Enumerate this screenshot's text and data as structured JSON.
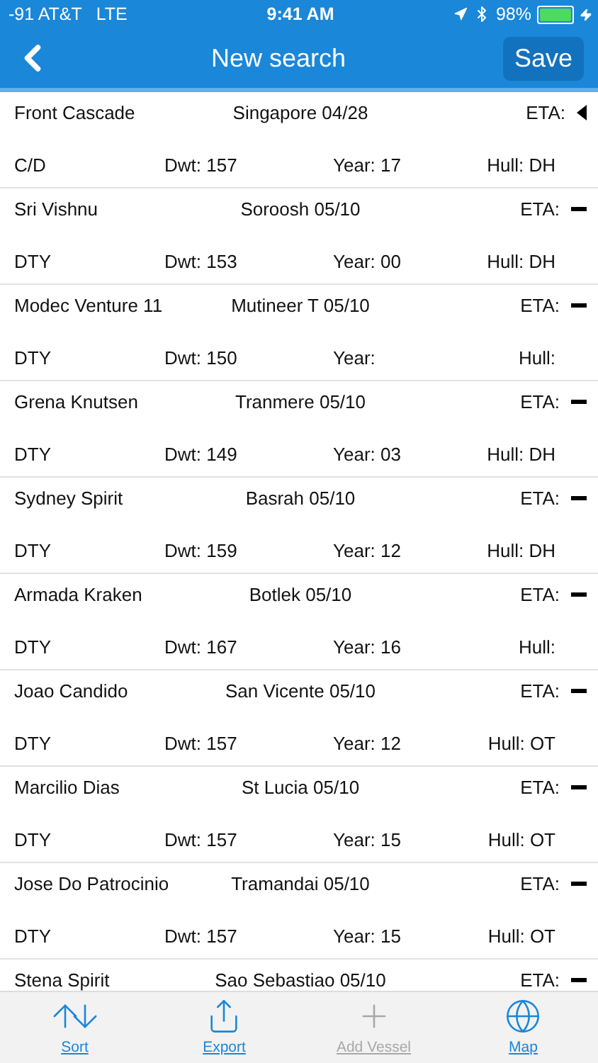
{
  "status_bar": {
    "carrier": "-91 AT&T",
    "network": "LTE",
    "time": "9:41 AM",
    "battery": "98%"
  },
  "nav": {
    "title": "New search",
    "action": "Save"
  },
  "vessels": [
    {
      "name": "Front Cascade",
      "port": "Singapore 04/28",
      "eta": "ETA:",
      "kind": "triangle",
      "type": "C/D",
      "dwt": "Dwt: 157",
      "year": "Year: 17",
      "hull": "Hull: DH"
    },
    {
      "name": "Sri Vishnu",
      "port": "Soroosh 05/10",
      "eta": "ETA:",
      "kind": "dash",
      "type": "DTY",
      "dwt": "Dwt: 153",
      "year": "Year: 00",
      "hull": "Hull: DH"
    },
    {
      "name": "Modec Venture 11",
      "port": "Mutineer T 05/10",
      "eta": "ETA:",
      "kind": "dash",
      "type": "DTY",
      "dwt": "Dwt: 150",
      "year": "Year:",
      "hull": "Hull:"
    },
    {
      "name": "Grena Knutsen",
      "port": "Tranmere 05/10",
      "eta": "ETA:",
      "kind": "dash",
      "type": "DTY",
      "dwt": "Dwt: 149",
      "year": "Year: 03",
      "hull": "Hull: DH"
    },
    {
      "name": "Sydney Spirit",
      "port": "Basrah 05/10",
      "eta": "ETA:",
      "kind": "dash",
      "type": "DTY",
      "dwt": "Dwt: 159",
      "year": "Year: 12",
      "hull": "Hull: DH"
    },
    {
      "name": "Armada Kraken",
      "port": "Botlek 05/10",
      "eta": "ETA:",
      "kind": "dash",
      "type": "DTY",
      "dwt": "Dwt: 167",
      "year": "Year: 16",
      "hull": "Hull:"
    },
    {
      "name": "Joao Candido",
      "port": "San Vicente 05/10",
      "eta": "ETA:",
      "kind": "dash",
      "type": "DTY",
      "dwt": "Dwt: 157",
      "year": "Year: 12",
      "hull": "Hull: OT"
    },
    {
      "name": "Marcilio Dias",
      "port": "St Lucia 05/10",
      "eta": "ETA:",
      "kind": "dash",
      "type": "DTY",
      "dwt": "Dwt: 157",
      "year": "Year: 15",
      "hull": "Hull: OT"
    },
    {
      "name": "Jose Do Patrocinio",
      "port": "Tramandai 05/10",
      "eta": "ETA:",
      "kind": "dash",
      "type": "DTY",
      "dwt": "Dwt: 157",
      "year": "Year: 15",
      "hull": "Hull: OT"
    },
    {
      "name": "Stena Spirit",
      "port": "Sao Sebastiao 05/10",
      "eta": "ETA:",
      "kind": "dash"
    }
  ],
  "toolbar": [
    {
      "label": "Sort",
      "kind": "sort",
      "disabled": false
    },
    {
      "label": "Export",
      "kind": "export",
      "disabled": false
    },
    {
      "label": "Add Vessel",
      "kind": "add",
      "disabled": true
    },
    {
      "label": "Map",
      "kind": "map",
      "disabled": false
    }
  ]
}
